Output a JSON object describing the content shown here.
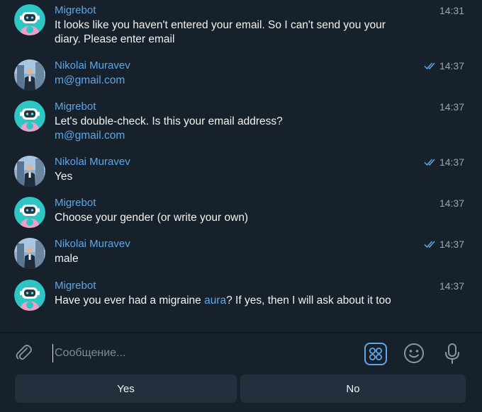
{
  "messages": [
    {
      "author": "Migrebot",
      "type": "bot",
      "time": "14:31",
      "lines": [
        "It looks like you haven't entered your email. So I can't send you your",
        "diary. Please enter email"
      ]
    },
    {
      "author": "Nikolai Muravev",
      "type": "user",
      "time": "14:37",
      "read": true,
      "link_lines": [
        "m@gmail.com"
      ]
    },
    {
      "author": "Migrebot",
      "type": "bot",
      "time": "14:37",
      "lines": [
        "Let's double-check. Is this your email address?"
      ],
      "link_lines": [
        "m@gmail.com"
      ]
    },
    {
      "author": "Nikolai Muravev",
      "type": "user",
      "time": "14:37",
      "read": true,
      "lines": [
        "Yes"
      ]
    },
    {
      "author": "Migrebot",
      "type": "bot",
      "time": "14:37",
      "lines": [
        "Choose your gender (or write your own)"
      ]
    },
    {
      "author": "Nikolai Muravev",
      "type": "user",
      "time": "14:37",
      "read": true,
      "lines": [
        "male"
      ]
    },
    {
      "author": "Migrebot",
      "type": "bot",
      "time": "14:37",
      "text_before": "Have you ever had a migraine ",
      "link": "aura",
      "text_after": "? If yes, then I will ask about it too"
    }
  ],
  "composer": {
    "placeholder": "Сообщение..."
  },
  "keyboard": {
    "buttons": [
      "Yes",
      "No"
    ]
  },
  "colors": {
    "background": "#17212b",
    "accent": "#5fa6e8",
    "button_bg": "#232f3d",
    "bot_avatar_bg": "#2fc5c2"
  },
  "icons": {
    "attach": "paperclip-icon",
    "commands": "bot-commands-icon",
    "emoji": "emoji-icon",
    "mic": "microphone-icon",
    "read": "double-check-icon"
  }
}
